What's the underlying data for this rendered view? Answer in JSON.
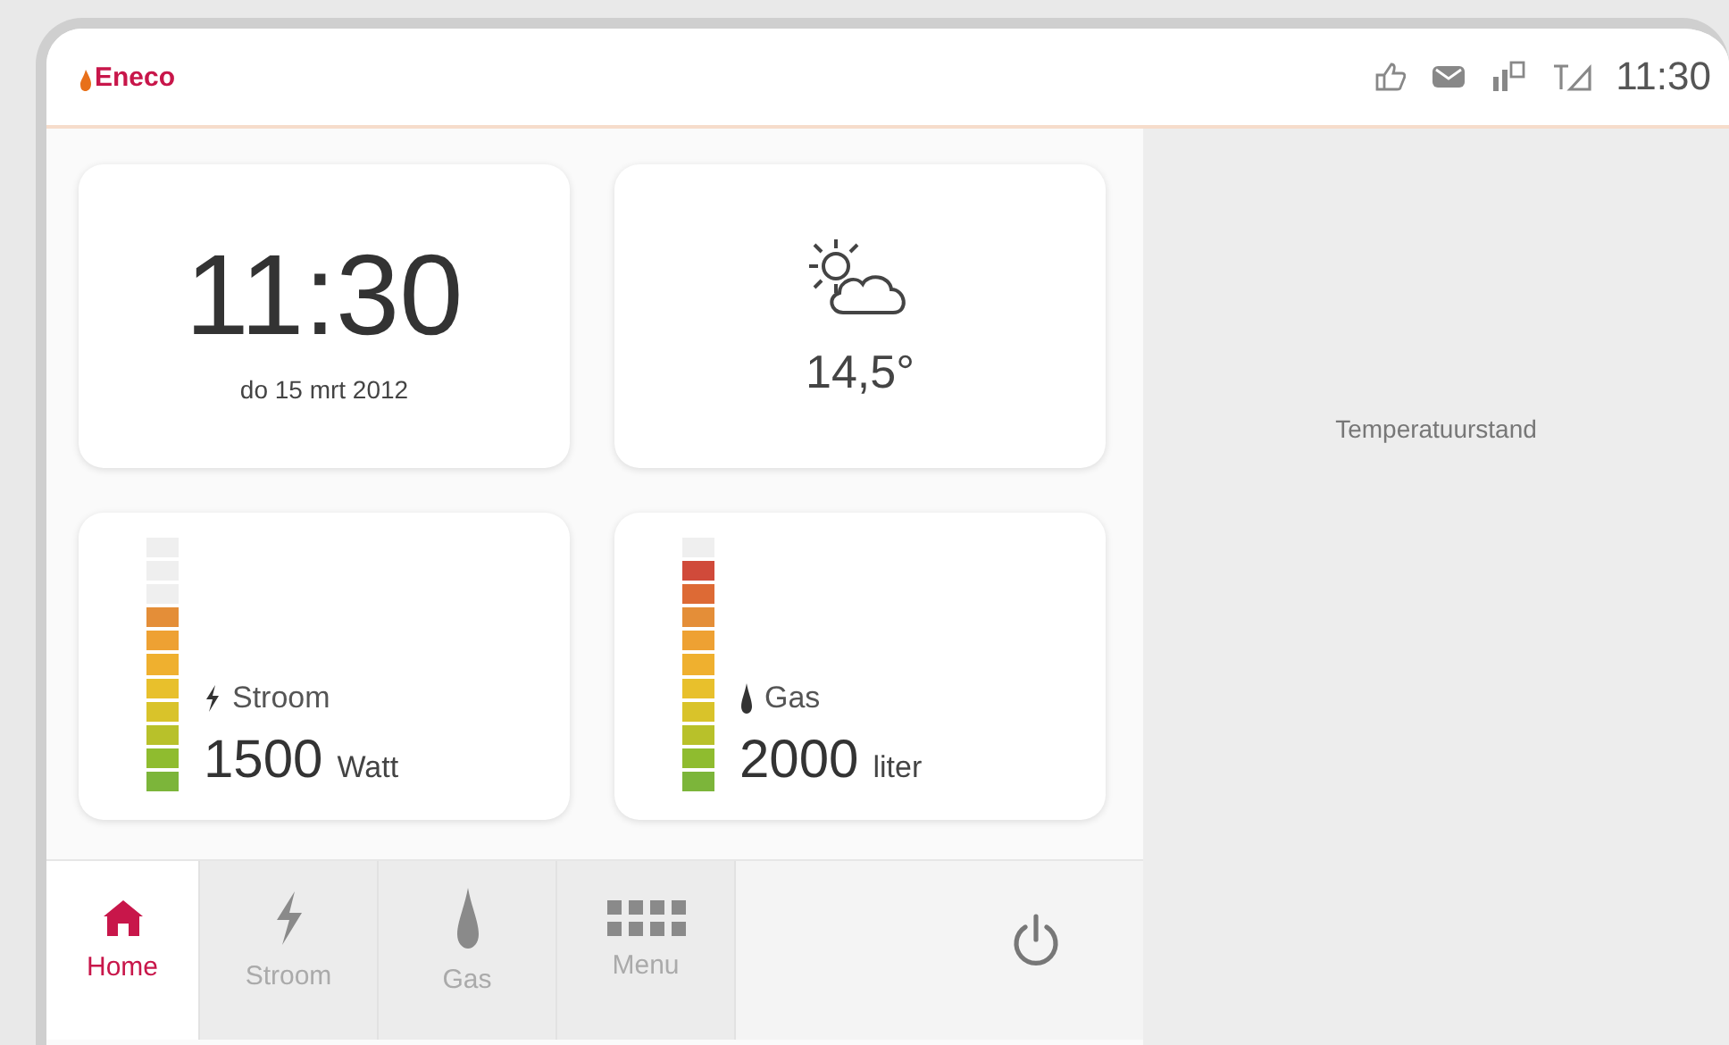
{
  "header": {
    "logo": "Eneco",
    "time": "11:30"
  },
  "clock": {
    "time": "11:30",
    "date": "do 15 mrt 2012"
  },
  "weather": {
    "temperature": "14,5°"
  },
  "meters": [
    {
      "kind": "power",
      "label": "Stroom",
      "value": "1500",
      "unit": "Watt",
      "level": 0.73
    },
    {
      "kind": "gas",
      "label": "Gas",
      "value": "2000",
      "unit": "liter",
      "level": 0.91
    }
  ],
  "side_panel": {
    "label": "Temperatuurstand"
  },
  "nav": [
    {
      "kind": "home",
      "label": "Home",
      "selected": true
    },
    {
      "kind": "power",
      "label": "Stroom",
      "selected": false
    },
    {
      "kind": "gas",
      "label": "Gas",
      "selected": false
    },
    {
      "kind": "menu",
      "label": "Menu",
      "selected": false
    }
  ]
}
